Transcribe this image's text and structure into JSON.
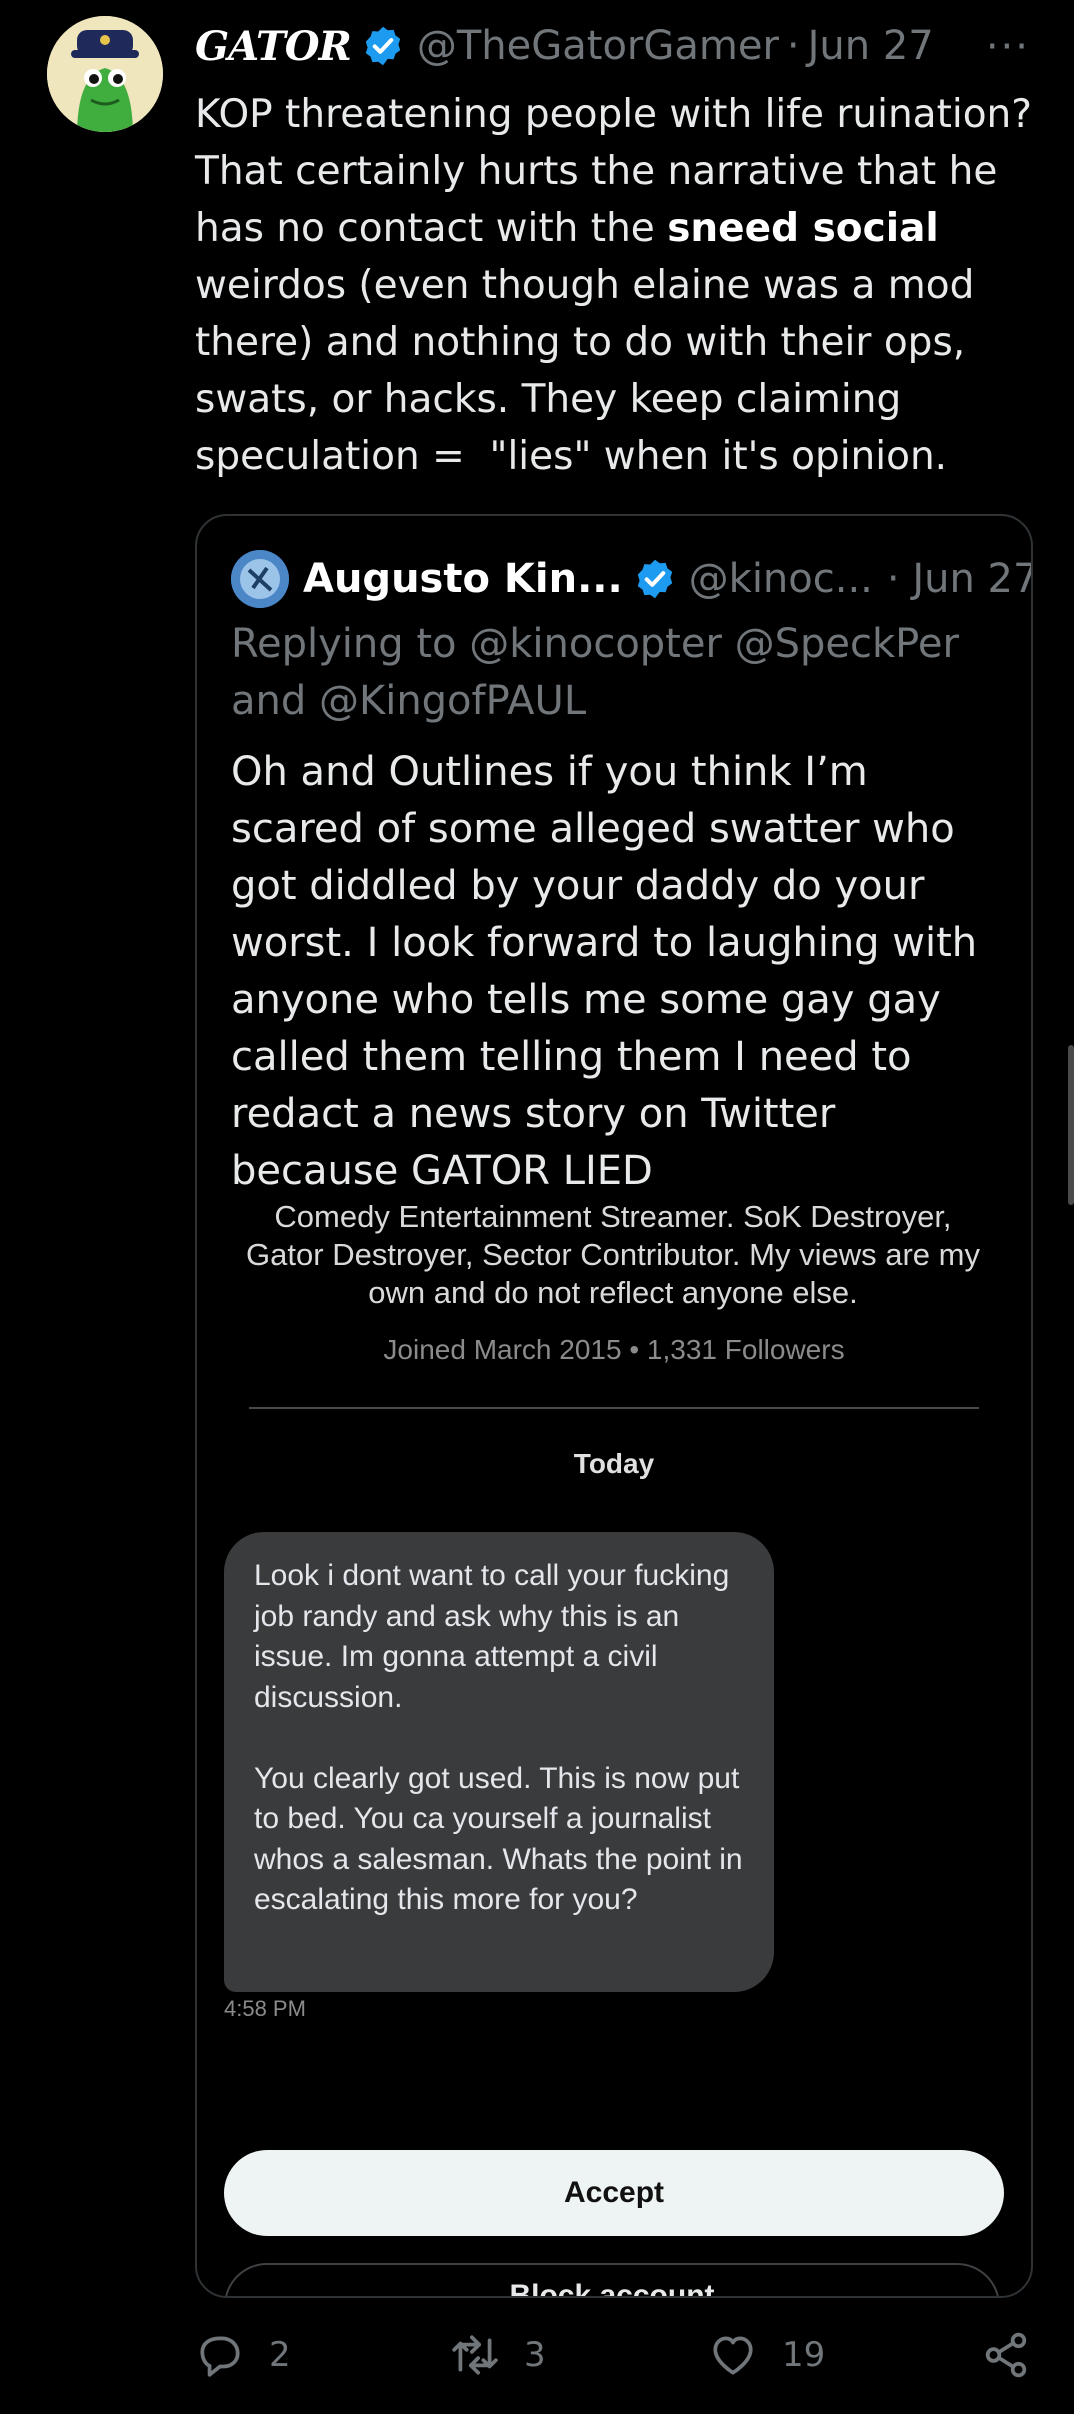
{
  "tweet": {
    "author_name": "GATOR",
    "author_handle": "@TheGatorGamer",
    "separator": "·",
    "date": "Jun 27",
    "more_label": "···",
    "text_part1": "KOP threatening people with life ruination? That certainly hurts the narrative that he has no contact with the ",
    "text_bold": "sneed social",
    "text_part2": " weirdos (even though elaine was a mod there) and nothing to do with their ops, swats, or hacks. They keep claiming speculation =  \"lies\" when it's opinion."
  },
  "quote": {
    "author_name": "Augusto Kin...",
    "author_handle": "@kinoc...",
    "date": "· Jun 27",
    "replying_to": "Replying to @kinocopter @SpeckPer and @KingofPAUL",
    "text": "Oh and Outlines if you think I’m scared of some alleged swatter who got diddled by your daddy do your worst. I look forward to laughing with anyone who tells me some gay gay called them telling them I need to redact a news story on Twitter because GATOR LIED",
    "screenshot": {
      "bio": "Comedy Entertainment Streamer. SoK Destroyer, Gator Destroyer, Sector Contributor. My views are my own and do not reflect anyone else.",
      "joined": "Joined March 2015 • 1,331 Followers",
      "day_label": "Today",
      "message": "Look i dont want to call your fucking job randy and ask why this is an issue. Im gonna attempt a civil discussion.\n\nYou clearly got used. This is now put to bed. You ca yourself a journalist whos a salesman. Whats the point in escalating this more for you?",
      "message_time": "4:58 PM",
      "accept_label": "Accept",
      "block_label": "Block account"
    }
  },
  "actions": {
    "replies": "2",
    "retweets": "3",
    "likes": "19"
  },
  "colors": {
    "background": "#000000",
    "text": "#e7e9ea",
    "muted": "#71767b",
    "verified": "#1d9bf0"
  },
  "icons": [
    "verified-badge-icon",
    "reply-icon",
    "retweet-icon",
    "like-icon",
    "share-icon",
    "more-icon"
  ]
}
